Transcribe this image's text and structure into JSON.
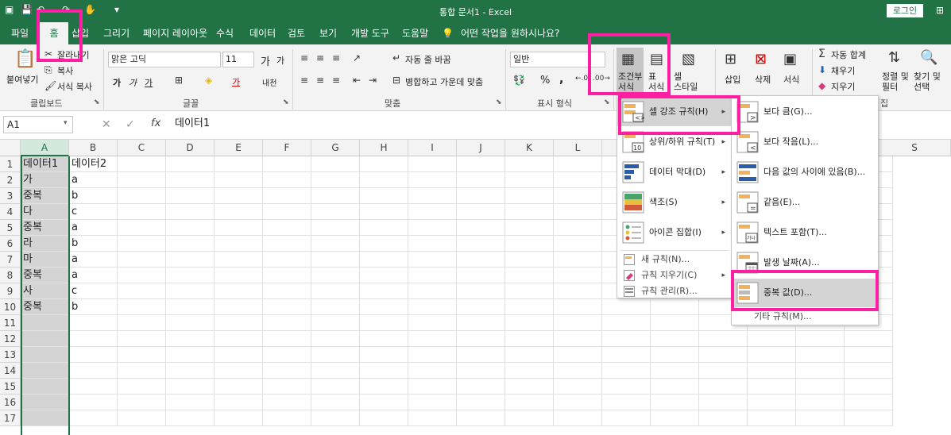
{
  "title_bar": {
    "title": "통합 문서1  -  Excel",
    "login": "로그인",
    "qa_more": "▾"
  },
  "tabs": [
    "파일",
    "홈",
    "삽입",
    "그리기",
    "페이지 레이아웃",
    "수식",
    "데이터",
    "검토",
    "보기",
    "개발 도구",
    "도움말"
  ],
  "tell_me": "어떤 작업을 원하시나요?",
  "ribbon": {
    "clipboard": {
      "paste": "붙여넣기",
      "cut": "잘라내기",
      "copy": "복사",
      "format_painter": "서식 복사",
      "label": "클립보드"
    },
    "font": {
      "name": "맑은 고딕",
      "size": "11",
      "grow": "가",
      "shrink": "가",
      "bold": "가",
      "italic": "가",
      "underline": "가",
      "font_color_char": "가",
      "phonetic": "내천",
      "label": "글꼴"
    },
    "alignment": {
      "wrap": "자동 줄 바꿈",
      "merge": "병합하고 가운데 맞춤",
      "label": "맞춤"
    },
    "number": {
      "format": "일반",
      "percent": "%",
      "comma": ",",
      "label": "표시 형식"
    },
    "styles": {
      "conditional": "조건부\n서식",
      "table": "표\n서식",
      "cell_styles": "셀\n스타일"
    },
    "cells": {
      "insert": "삽입",
      "delete": "삭제",
      "format": "서식"
    },
    "editing": {
      "autosum": "자동 합계",
      "fill": "채우기",
      "clear": "지우기",
      "sort": "정렬 및\n필터",
      "find": "찾기 및\n선택",
      "label_tail": "집"
    }
  },
  "formula_bar": {
    "namebox": "A1",
    "fx": "fx",
    "value": "데이터1"
  },
  "columns": [
    "A",
    "B",
    "C",
    "D",
    "E",
    "F",
    "G",
    "H",
    "I",
    "J",
    "K",
    "L",
    "M",
    "S"
  ],
  "rows": [
    {
      "n": "1",
      "a": "데이터1",
      "b": "데이터2"
    },
    {
      "n": "2",
      "a": "가",
      "b": "a"
    },
    {
      "n": "3",
      "a": "중복",
      "b": "b"
    },
    {
      "n": "4",
      "a": "다",
      "b": "c"
    },
    {
      "n": "5",
      "a": "중복",
      "b": "a"
    },
    {
      "n": "6",
      "a": "라",
      "b": "b"
    },
    {
      "n": "7",
      "a": "마",
      "b": "a"
    },
    {
      "n": "8",
      "a": "중복",
      "b": "a"
    },
    {
      "n": "9",
      "a": "사",
      "b": "c"
    },
    {
      "n": "10",
      "a": "중복",
      "b": "b"
    },
    {
      "n": "11",
      "a": "",
      "b": ""
    },
    {
      "n": "12",
      "a": "",
      "b": ""
    },
    {
      "n": "13",
      "a": "",
      "b": ""
    },
    {
      "n": "14",
      "a": "",
      "b": ""
    },
    {
      "n": "15",
      "a": "",
      "b": ""
    },
    {
      "n": "16",
      "a": "",
      "b": ""
    },
    {
      "n": "17",
      "a": "",
      "b": ""
    }
  ],
  "cf_menu": {
    "items": [
      {
        "label": "셀 강조 규칙(H)"
      },
      {
        "label": "상위/하위 규칙(T)"
      },
      {
        "label": "데이터 막대(D)"
      },
      {
        "label": "색조(S)"
      },
      {
        "label": "아이콘 집합(I)"
      }
    ],
    "small": [
      {
        "label": "새 규칙(N)..."
      },
      {
        "label": "규칙 지우기(C)"
      },
      {
        "label": "규칙 관리(R)..."
      }
    ]
  },
  "highlight_submenu": {
    "items": [
      {
        "label": "보다 큼(G)..."
      },
      {
        "label": "보다 작음(L)..."
      },
      {
        "label": "다음 값의 사이에 있음(B)..."
      },
      {
        "label": "같음(E)..."
      },
      {
        "label": "텍스트 포함(T)..."
      },
      {
        "label": "발생 날짜(A)..."
      },
      {
        "label": "중복 값(D)..."
      }
    ],
    "more": "기타 규칙(M)..."
  },
  "colors": {
    "excel_green": "#217346",
    "highlight": "#ff1fa3",
    "hover_gray": "#d4d4d4"
  }
}
